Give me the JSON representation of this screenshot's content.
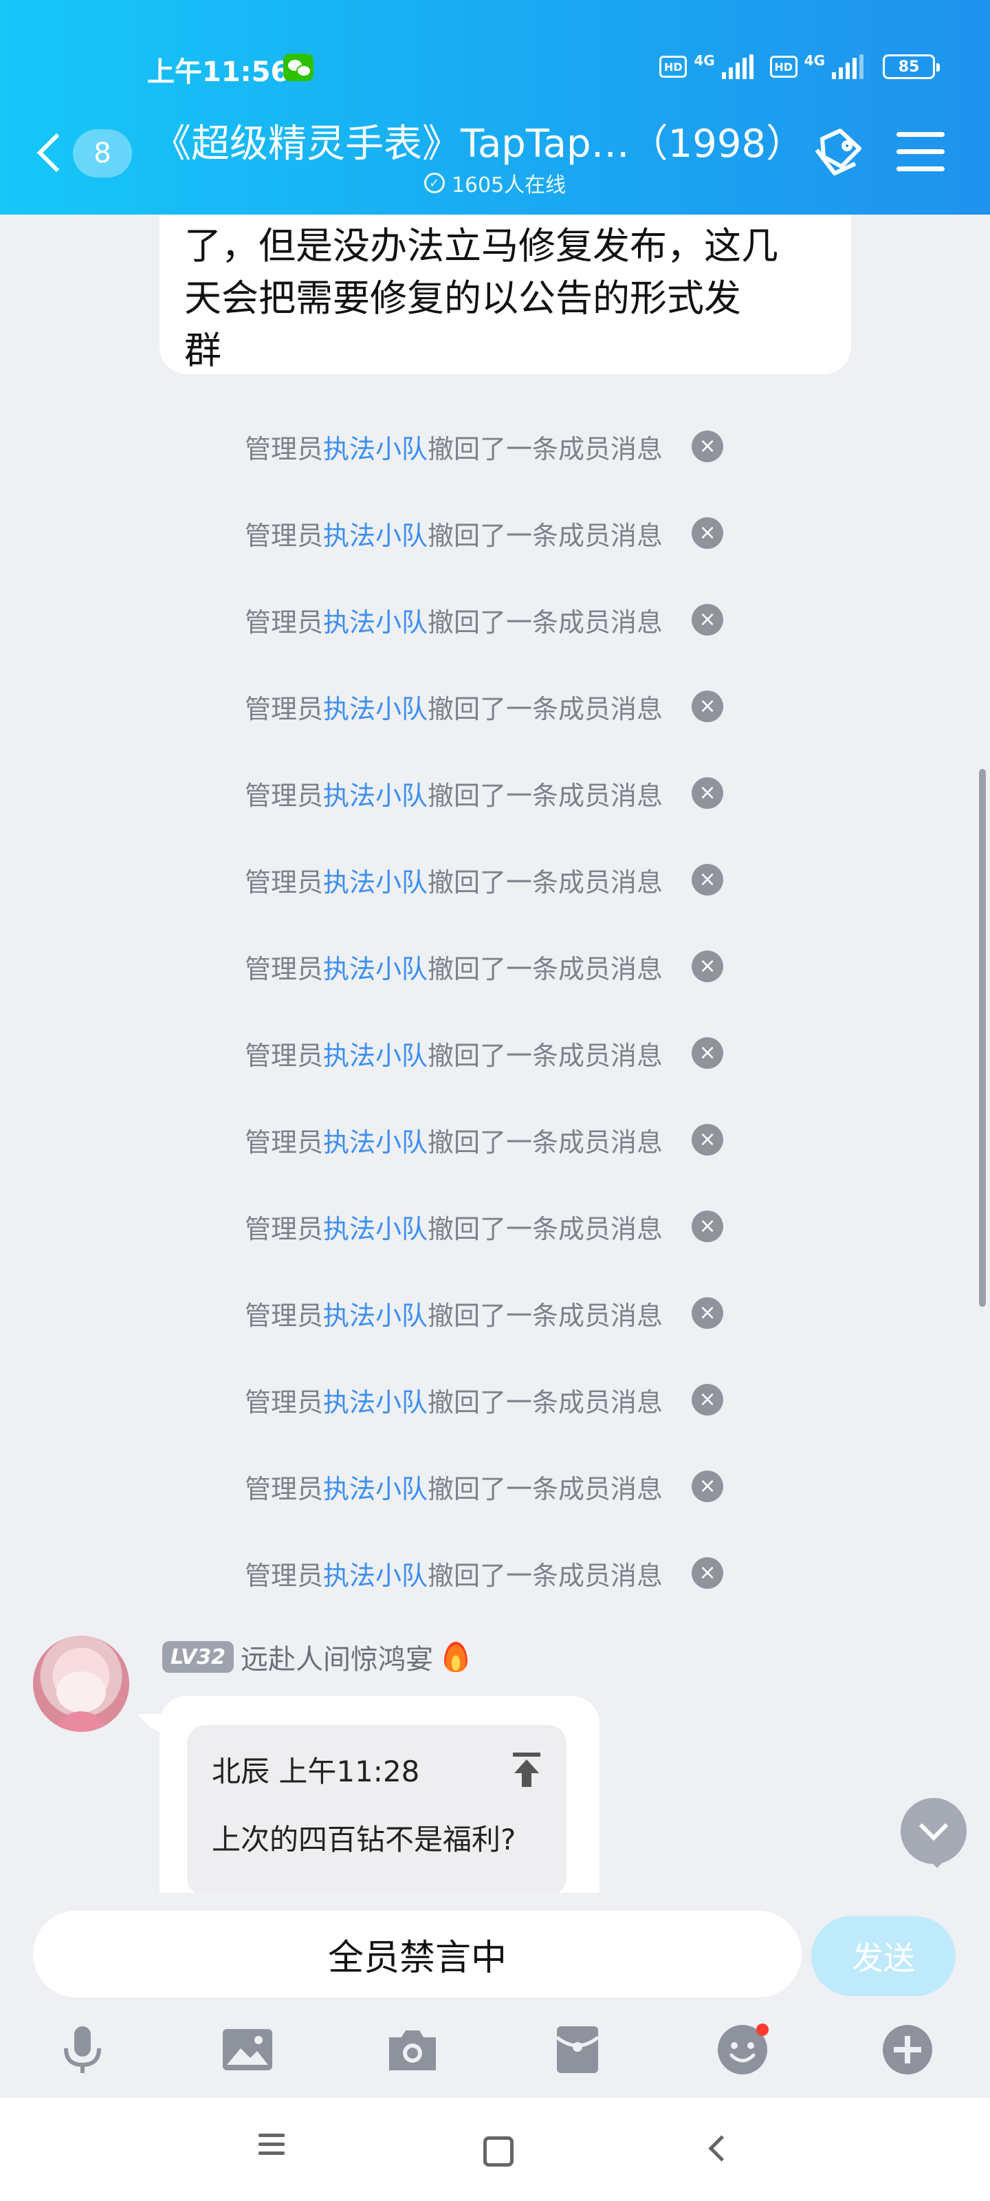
{
  "status_bar": {
    "time": "上午11:56",
    "hd_label": "HD",
    "network_1": "4G",
    "network_2": "4G",
    "battery": "85"
  },
  "header": {
    "unread_count": "8",
    "title": "《超级精灵手表》TapTap…（1998）",
    "online_text": "1605人在线"
  },
  "chat": {
    "top_bubble_lines": [
      "了，但是没办法立马修复发布，这几",
      "天会把需要修复的以公告的形式发",
      "群"
    ],
    "system_messages": [
      {
        "prefix": "管理员",
        "admin": "执法小队",
        "suffix": "撤回了一条成员消息"
      },
      {
        "prefix": "管理员",
        "admin": "执法小队",
        "suffix": "撤回了一条成员消息"
      },
      {
        "prefix": "管理员",
        "admin": "执法小队",
        "suffix": "撤回了一条成员消息"
      },
      {
        "prefix": "管理员",
        "admin": "执法小队",
        "suffix": "撤回了一条成员消息"
      },
      {
        "prefix": "管理员",
        "admin": "执法小队",
        "suffix": "撤回了一条成员消息"
      },
      {
        "prefix": "管理员",
        "admin": "执法小队",
        "suffix": "撤回了一条成员消息"
      },
      {
        "prefix": "管理员",
        "admin": "执法小队",
        "suffix": "撤回了一条成员消息"
      },
      {
        "prefix": "管理员",
        "admin": "执法小队",
        "suffix": "撤回了一条成员消息"
      },
      {
        "prefix": "管理员",
        "admin": "执法小队",
        "suffix": "撤回了一条成员消息"
      },
      {
        "prefix": "管理员",
        "admin": "执法小队",
        "suffix": "撤回了一条成员消息"
      },
      {
        "prefix": "管理员",
        "admin": "执法小队",
        "suffix": "撤回了一条成员消息"
      },
      {
        "prefix": "管理员",
        "admin": "执法小队",
        "suffix": "撤回了一条成员消息"
      },
      {
        "prefix": "管理员",
        "admin": "执法小队",
        "suffix": "撤回了一条成员消息"
      },
      {
        "prefix": "管理员",
        "admin": "执法小队",
        "suffix": "撤回了一条成员消息"
      }
    ],
    "last_message": {
      "level": "LV32",
      "sender": "远赴人间惊鸿宴",
      "quote_meta": "北辰 上午11:28",
      "quote_text": "上次的四百钻不是福利?"
    }
  },
  "input": {
    "muted_text": "全员禁言中",
    "send_label": "发送"
  },
  "toolbar_icons": [
    "mic-icon",
    "image-icon",
    "camera-icon",
    "red-packet-icon",
    "emoji-icon",
    "plus-icon"
  ],
  "nav_icons": [
    "menu-icon",
    "home-icon",
    "back-icon"
  ],
  "colors": {
    "header_start": "#16c7f8",
    "header_end": "#1f93ee",
    "admin_link": "#3d8ff2",
    "chat_bg": "#eef0f4",
    "send_disabled": "#bfeafc"
  }
}
